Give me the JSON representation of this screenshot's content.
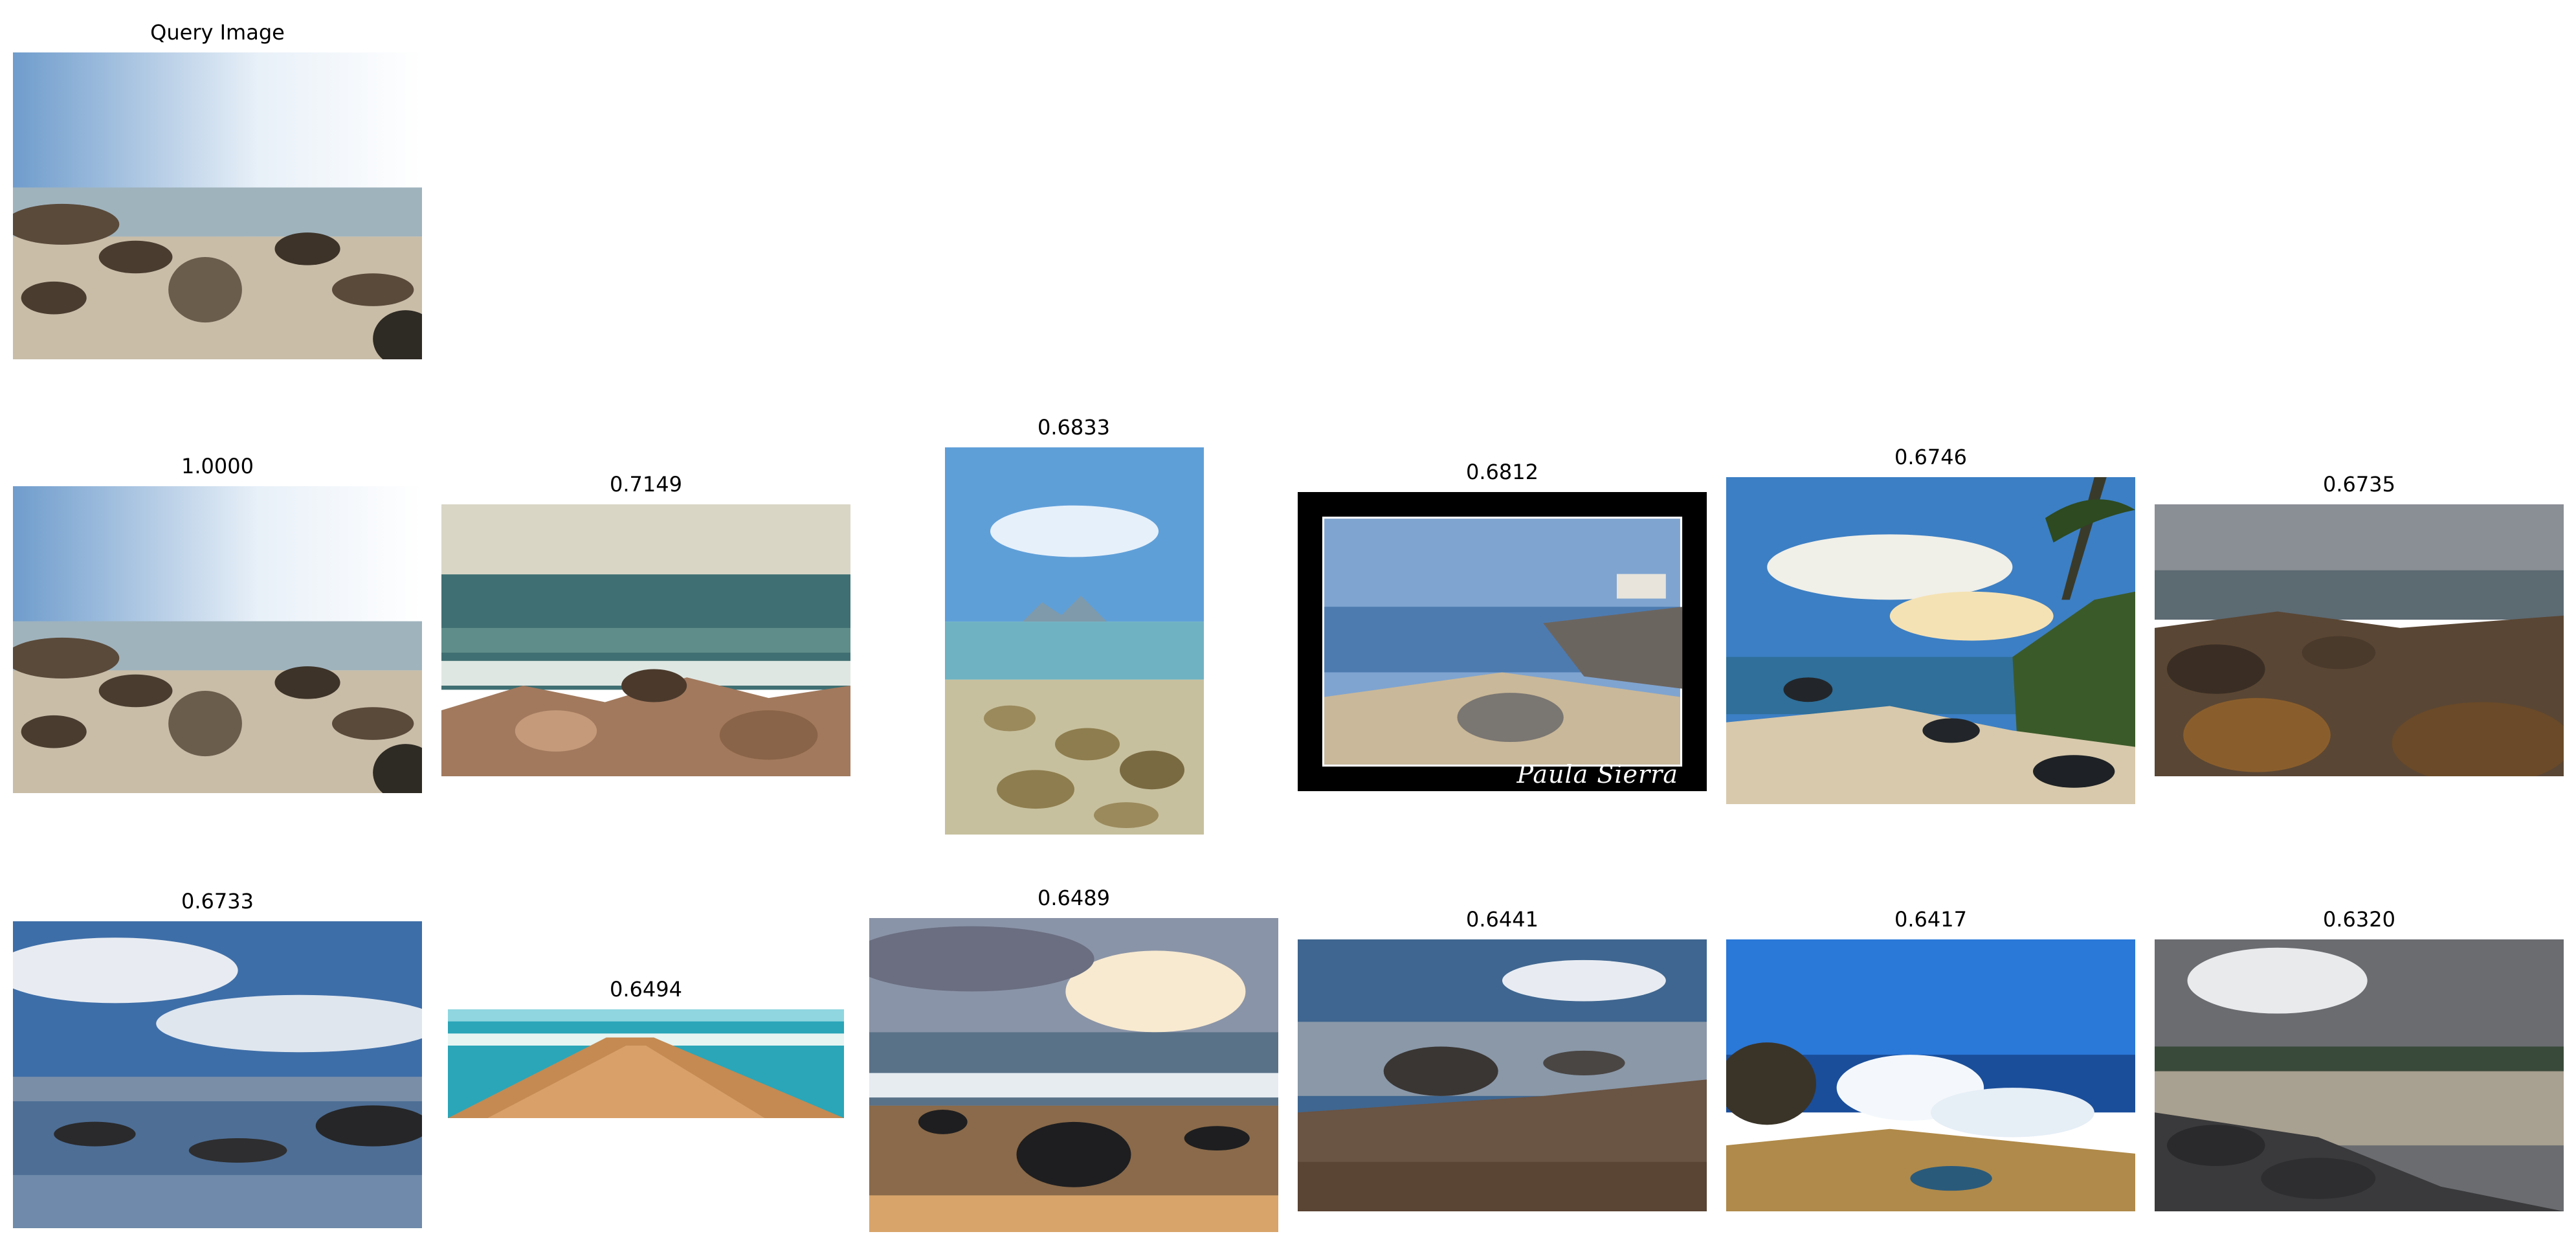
{
  "query": {
    "title": "Query Image"
  },
  "results": [
    {
      "score": "1.0000"
    },
    {
      "score": "0.7149"
    },
    {
      "score": "0.6833"
    },
    {
      "score": "0.6812",
      "watermark": "Paula Sierra"
    },
    {
      "score": "0.6746"
    },
    {
      "score": "0.6735"
    },
    {
      "score": "0.6733"
    },
    {
      "score": "0.6494"
    },
    {
      "score": "0.6489"
    },
    {
      "score": "0.6441"
    },
    {
      "score": "0.6417"
    },
    {
      "score": "0.6320"
    }
  ]
}
